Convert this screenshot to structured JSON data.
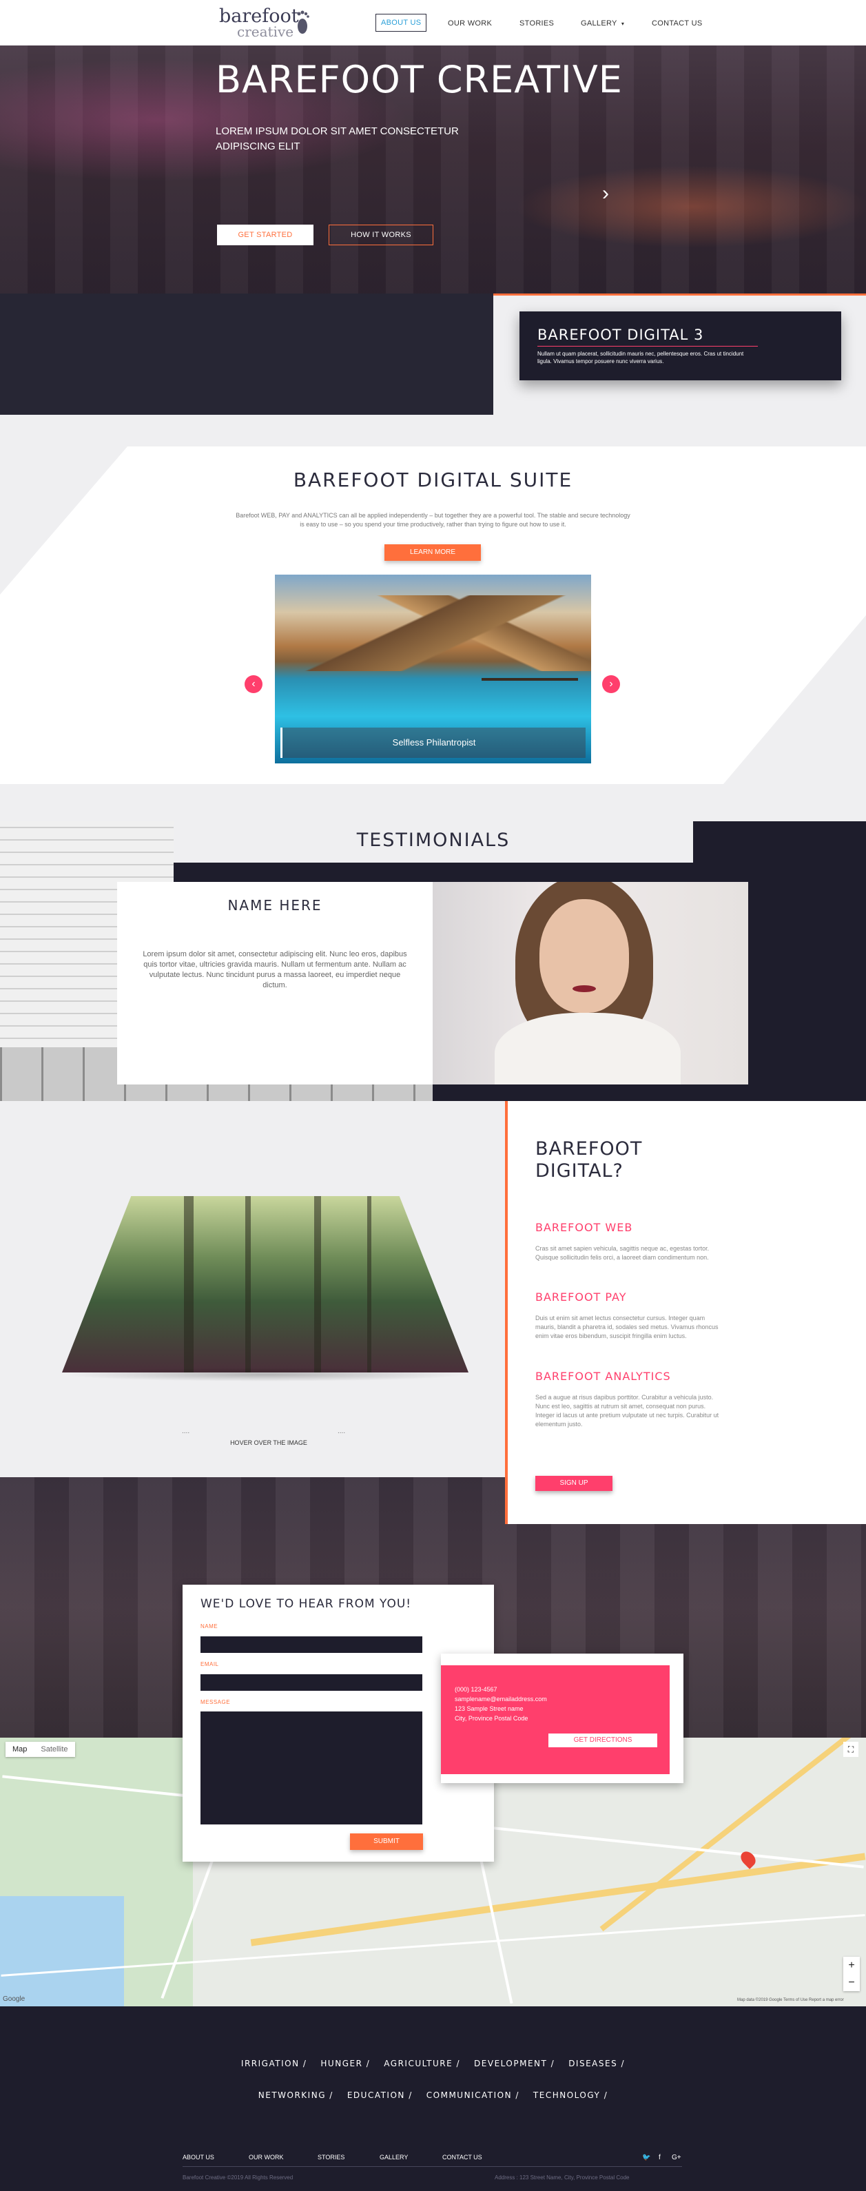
{
  "nav": {
    "logo_text": "barefoot",
    "logo_sub": "creative",
    "items": [
      "ABOUT US",
      "OUR WORK",
      "STORIES",
      "GALLERY",
      "CONTACT US"
    ],
    "active": "ABOUT US",
    "caret": "▾"
  },
  "hero": {
    "title": "BAREFOOT CREATIVE",
    "subtitle": "LOREM IPSUM DOLOR SIT AMET CONSECTETUR ADIPISCING ELIT",
    "btn_primary": "GET STARTED",
    "btn_secondary": "HOW IT WORKS",
    "arrow": "›"
  },
  "digital3": {
    "title": "BAREFOOT DIGITAL 3",
    "text": "Nullam ut quam placerat, sollicitudin mauris nec, pellentesque eros. Cras ut tincidunt ligula. Vivamus tempor posuere nunc viverra varius."
  },
  "suite": {
    "title": "BAREFOOT DIGITAL SUITE",
    "text": "Barefoot WEB, PAY and ANALYTICS can all be applied independently – but together they are a powerful tool. The stable and secure technology is easy to use – so you spend your time productively, rather than trying to figure out how to use it.",
    "button": "LEARN MORE",
    "slide_caption": "Selfless Philantropist",
    "prev": "‹",
    "next": "›"
  },
  "testimonials": {
    "title": "TESTIMONIALS",
    "name": "NAME HERE",
    "quote": "Lorem ipsum dolor sit amet, consectetur adipiscing elit. Nunc leo eros, dapibus quis tortor vitae, ultricies gravida mauris. Nullam ut fermentum ante. Nullam ac vulputate lectus. Nunc tincidunt purus a massa laoreet, eu imperdiet neque dictum."
  },
  "digital": {
    "title": "BAREFOOT DIGITAL?",
    "hover_label": "HOVER OVER THE IMAGE",
    "dots": "....",
    "sections": [
      {
        "heading": "BAREFOOT WEB",
        "text": "Cras sit amet sapien vehicula, sagittis neque ac, egestas tortor. Quisque sollicitudin felis orci, a laoreet diam condimentum non."
      },
      {
        "heading": "BAREFOOT PAY",
        "text": "Duis ut enim sit amet lectus consectetur cursus. Integer quam mauris, blandit a pharetra id, sodales sed metus. Vivamus rhoncus enim vitae eros bibendum, suscipit fringilla enim luctus."
      },
      {
        "heading": "BAREFOOT ANALYTICS",
        "text": "Sed a augue at risus dapibus porttitor. Curabitur a vehicula justo. Nunc est leo, sagittis at rutrum sit amet, consequat non purus. Integer id lacus ut ante pretium vulputate ut nec turpis. Curabitur ut elementum justo."
      }
    ],
    "signup": "SIGN UP"
  },
  "contact": {
    "title": "WE'D LOVE TO HEAR FROM YOU!",
    "name_label": "NAME",
    "email_label": "EMAIL",
    "message_label": "MESSAGE",
    "submit": "SUBMIT",
    "phone": "(000) 123-4567",
    "email": "samplename@emailaddress.com",
    "address1": "123 Sample Street name",
    "address2": "City, Province Postal Code",
    "directions": "GET DIRECTIONS"
  },
  "map": {
    "tab_map": "Map",
    "tab_satellite": "Satellite",
    "zoom_in": "+",
    "zoom_out": "−",
    "google": "Google",
    "terms": "Map data ©2019 Google   Terms of Use   Report a map error",
    "fullscreen": "⛶"
  },
  "footer": {
    "row1": [
      "IRRIGATION /",
      "HUNGER /",
      "AGRICULTURE /",
      "DEVELOPMENT /",
      "DISEASES /"
    ],
    "row2": [
      "NETWORKING /",
      "EDUCATION /",
      "COMMUNICATION /",
      "TECHNOLOGY /"
    ],
    "nav": [
      "ABOUT US",
      "OUR WORK",
      "STORIES",
      "GALLERY",
      "CONTACT US"
    ],
    "social": [
      "🐦",
      "f",
      "G+"
    ],
    "copyright": "Barefoot Creative ©2019 All Rights Reserved",
    "address": "Address : 123 Street Name, City, Province Postal Code"
  },
  "colors": {
    "accent_orange": "#ff6f3c",
    "accent_pink": "#ff3f6c",
    "navy": "#1e1d2c"
  }
}
